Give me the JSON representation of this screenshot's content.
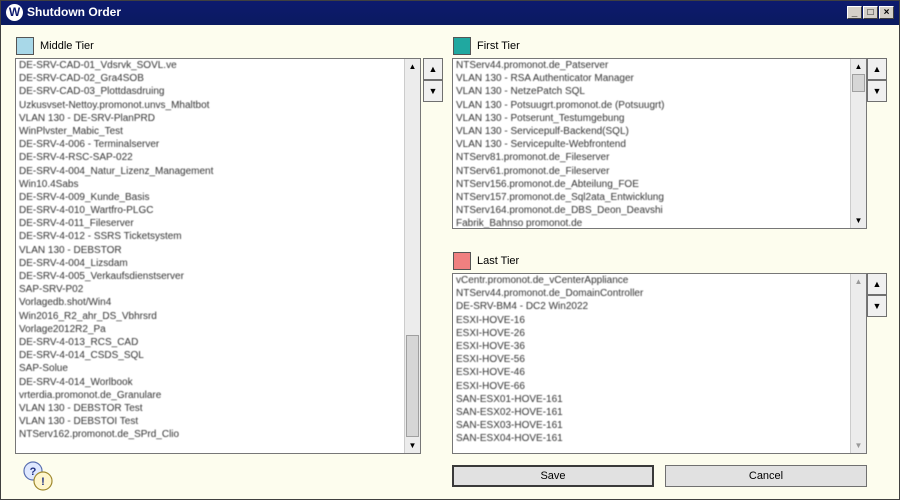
{
  "window": {
    "title": "Shutdown Order"
  },
  "middle_tier": {
    "label": "Middle Tier",
    "color": "#a8d8e8",
    "items": [
      "DE-SRV-CAD-01_Vdsrvk_SOVL.ve",
      "DE-SRV-CAD-02_Gra4SOB",
      "DE-SRV-CAD-03_Plottdasdruing",
      "Uzkusvset-Nettoy.promonot.unvs_Mhaltbot",
      "VLAN 130 - DE-SRV-PlanPRD",
      "WinPlvster_Mabic_Test",
      "DE-SRV-4-006 - Terminalserver",
      "DE-SRV-4-RSC-SAP-022",
      "DE-SRV-4-004_Natur_Lizenz_Management",
      "Win10.4Sabs",
      "DE-SRV-4-009_Kunde_Basis",
      "DE-SRV-4-010_Wartfro-PLGC",
      "DE-SRV-4-011_Fileserver",
      "DE-SRV-4-012 - SSRS Ticketsystem",
      "VLAN 130 - DEBSTOR",
      "DE-SRV-4-004_Lizsdam",
      "DE-SRV-4-005_Verkaufsdienstserver",
      "SAP-SRV-P02",
      "Vorlagedb.shot/Win4",
      "Win2016_R2_ahr_DS_Vbhrsrd",
      "Vorlage2012R2_Pa",
      "DE-SRV-4-013_RCS_CAD",
      "DE-SRV-4-014_CSDS_SQL",
      "SAP-Solue",
      "DE-SRV-4-014_Worlbook",
      "vrterdia.promonot.de_Granulare",
      "VLAN 130 - DEBSTOR Test",
      "VLAN 130 - DEBSTOI Test",
      "NTServ162.promonot.de_SPrd_Clio"
    ]
  },
  "first_tier": {
    "label": "First Tier",
    "color": "#20a8a0",
    "items": [
      "NTServ44.promonot.de_Patserver",
      "VLAN 130 - RSA Authenticator Manager",
      "VLAN 130 - NetzePatch SQL",
      "VLAN 130 - Potsuugrt.promonot.de (Potsuugrt)",
      "VLAN 130 - Potserunt_Testumgebung",
      "VLAN 130 - Servicepulf-Backend(SQL)",
      "VLAN 130 - Servicepulte-Webfrontend",
      "NTServ81.promonot.de_Fileserver",
      "NTServ61.promonot.de_Fileserver",
      "NTServ156.promonot.de_Abteilung_FOE",
      "NTServ157.promonot.de_Sql2ata_Entwicklung",
      "NTServ164.promonot.de_DBS_Deon_Deavshi",
      "Fabrik_Bahnso promonot.de"
    ]
  },
  "last_tier": {
    "label": "Last Tier",
    "color": "#f08080",
    "items": [
      "vCentr.promonot.de_vCenterAppliance",
      "NTServ44.promonot.de_DomainController",
      "DE-SRV-BM4 - DC2 Win2022",
      "ESXI-HOVE-16",
      "ESXI-HOVE-26",
      "ESXI-HOVE-36",
      "ESXI-HOVE-56",
      "ESXI-HOVE-46",
      "ESXI-HOVE-66",
      "SAN-ESX01-HOVE-161",
      "SAN-ESX02-HOVE-161",
      "SAN-ESX03-HOVE-161",
      "SAN-ESX04-HOVE-161"
    ]
  },
  "buttons": {
    "save": "Save",
    "cancel": "Cancel"
  },
  "icons": {
    "up": "triangle-up",
    "down": "triangle-down",
    "help": "help-question-icon"
  }
}
